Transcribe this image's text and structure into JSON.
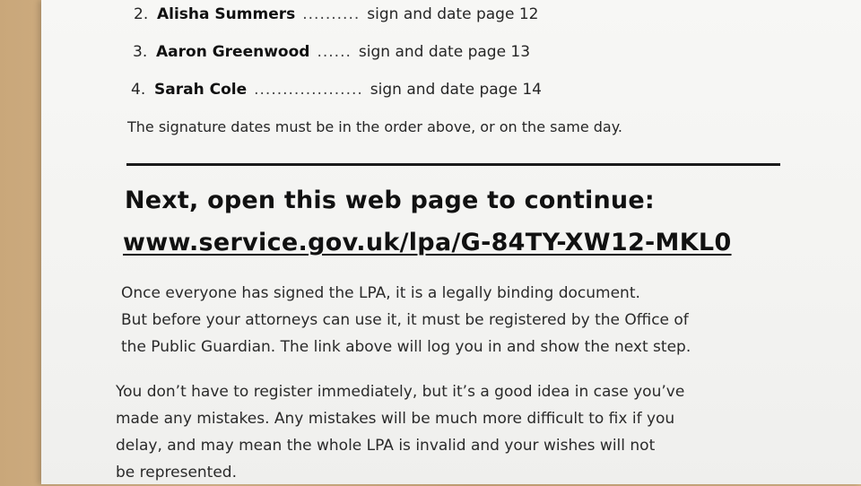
{
  "signers": [
    {
      "number": "2.",
      "name": "Alisha Summers",
      "dots": "..........",
      "action": "sign and date page 12"
    },
    {
      "number": "3.",
      "name": "Aaron Greenwood",
      "dots": "......",
      "action": "sign and date page 13"
    },
    {
      "number": "4.",
      "name": "Sarah Cole",
      "dots": "...................",
      "action": "sign and date page 14"
    }
  ],
  "order_note": "The signature dates must be in the order above, or on the same day.",
  "next_heading": "Next, open this web page to continue:",
  "link_text": "www.service.gov.uk/lpa/G-84TY-XW12-MKL0",
  "paragraph1": [
    "Once everyone has signed the LPA, it is a legally binding document.",
    "But before your attorneys can use it, it must be registered by the Office of",
    "the Public Guardian. The link above will log you in and show the next step."
  ],
  "paragraph2": [
    "You don’t have to register immediately, but it’s a good idea in case you’ve",
    "made any mistakes. Any mistakes will be much more difficult to fix if you",
    "delay, and may mean the whole LPA is invalid and your wishes will not",
    "be represented."
  ]
}
